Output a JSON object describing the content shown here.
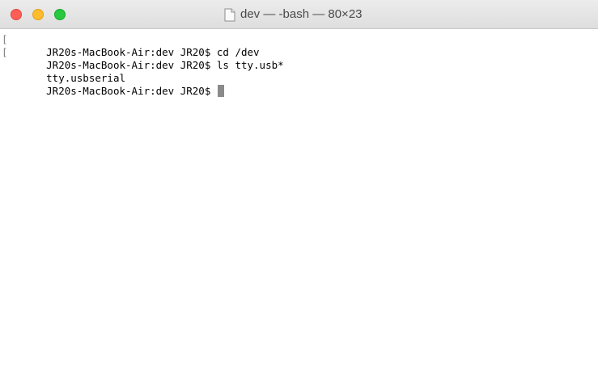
{
  "window": {
    "title": "dev — -bash — 80×23"
  },
  "terminal": {
    "lines": [
      {
        "mark": "[",
        "text": "JR20s-MacBook-Air:dev JR20$ cd /dev"
      },
      {
        "mark": "[",
        "text": "JR20s-MacBook-Air:dev JR20$ ls tty.usb*"
      },
      {
        "mark": "",
        "text": "tty.usbserial"
      },
      {
        "mark": "",
        "text": "JR20s-MacBook-Air:dev JR20$ "
      }
    ]
  },
  "colors": {
    "close": "#fd5f57",
    "minimize": "#febc2e",
    "zoom": "#28c840",
    "background": "#ffffff",
    "text": "#000000",
    "cursor": "#8a8a8a"
  },
  "icons": {
    "close": "close-icon",
    "minimize": "minimize-icon",
    "zoom": "zoom-icon",
    "document": "document-icon"
  }
}
